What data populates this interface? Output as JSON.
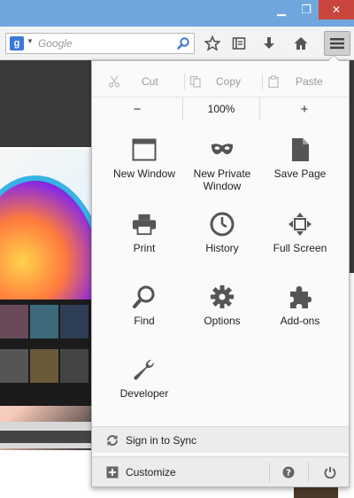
{
  "window": {
    "minimize_glyph": "▁",
    "maximize_glyph": "❐",
    "close_glyph": "✕"
  },
  "toolbar": {
    "search": {
      "engine_letter": "g",
      "placeholder": "Google"
    },
    "icons": [
      "star-icon",
      "bookmarks-list-icon",
      "download-icon",
      "home-icon",
      "hamburger-menu-icon"
    ]
  },
  "menu": {
    "edit": {
      "cut": "Cut",
      "copy": "Copy",
      "paste": "Paste"
    },
    "zoom": {
      "minus": "−",
      "value": "100%",
      "plus": "+"
    },
    "tiles": {
      "new_window": "New Window",
      "new_private_window": "New Private Window",
      "save_page": "Save Page",
      "print": "Print",
      "history": "History",
      "full_screen": "Full Screen",
      "find": "Find",
      "options": "Options",
      "addons": "Add-ons",
      "developer": "Developer"
    },
    "footer": {
      "sync": "Sign in to Sync",
      "customize": "Customize"
    }
  },
  "colors": {
    "titlebar": "#6fa6dd",
    "close": "#c9463d",
    "icon_dark": "#555555"
  }
}
